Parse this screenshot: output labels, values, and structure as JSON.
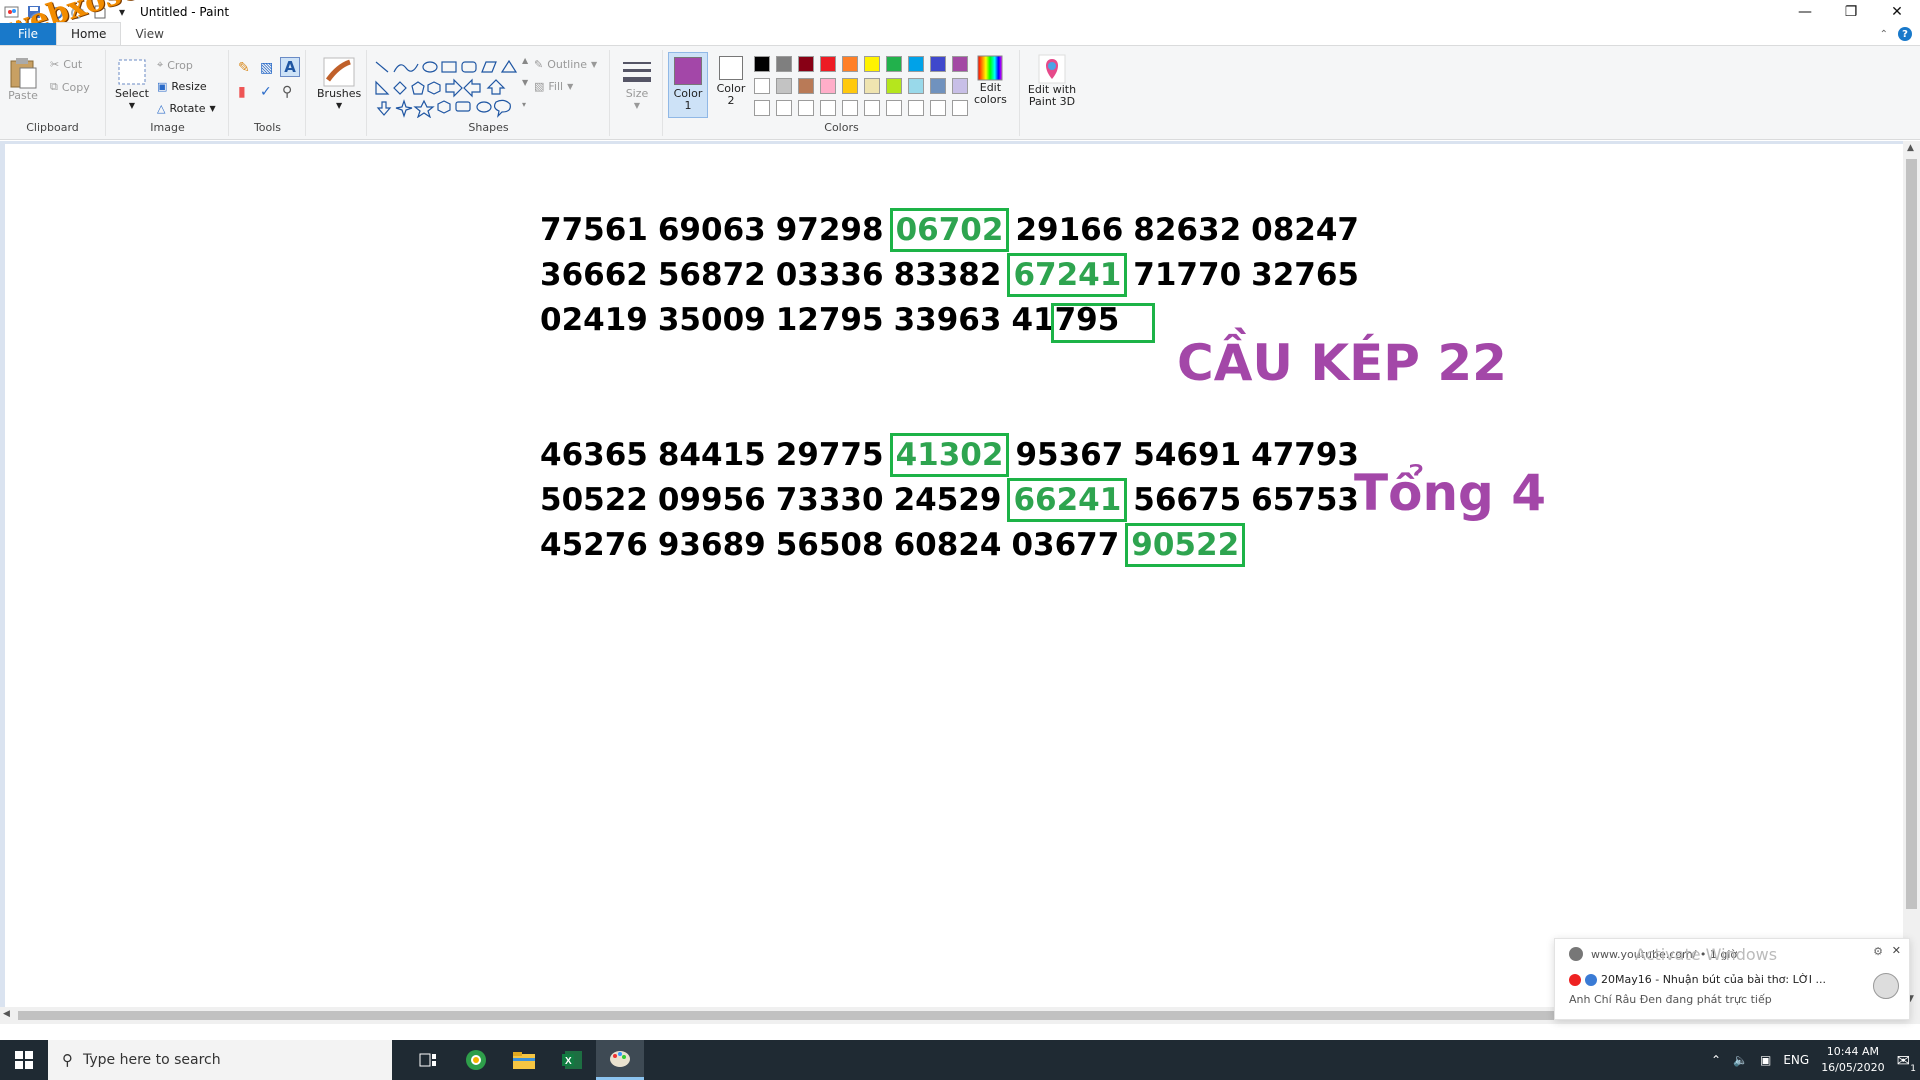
{
  "window": {
    "title": "Untitled - Paint",
    "controls": [
      "minimize",
      "maximize",
      "close"
    ]
  },
  "watermark": {
    "text": "webxoso.net"
  },
  "menu": {
    "tabs": [
      {
        "label": "File"
      },
      {
        "label": "Home"
      },
      {
        "label": "View"
      }
    ]
  },
  "ribbon": {
    "clipboard": {
      "group_label": "Clipboard",
      "paste_label": "Paste",
      "cut_label": "Cut",
      "copy_label": "Copy"
    },
    "image": {
      "group_label": "Image",
      "select_label": "Select",
      "crop_label": "Crop",
      "resize_label": "Resize",
      "rotate_label": "Rotate"
    },
    "tools": {
      "group_label": "Tools"
    },
    "brushes": {
      "label": "Brushes"
    },
    "shapes": {
      "group_label": "Shapes",
      "outline_label": "Outline",
      "fill_label": "Fill"
    },
    "size": {
      "label": "Size"
    },
    "colors": {
      "group_label": "Colors",
      "color1_label": "Color\n1",
      "color1_line1": "Color",
      "color1_line2": "1",
      "color2_line1": "Color",
      "color2_line2": "2",
      "color1_value": "#a347a8",
      "color2_value": "#ffffff",
      "edit_colors_line1": "Edit",
      "edit_colors_line2": "colors",
      "palette_row1": [
        "#000000",
        "#7f7f7f",
        "#880015",
        "#ed1c24",
        "#ff7f27",
        "#fff200",
        "#22b14c",
        "#00a2e8",
        "#3f48cc",
        "#a349a4"
      ],
      "palette_row2": [
        "#ffffff",
        "#c3c3c3",
        "#b97a57",
        "#ffaec9",
        "#ffc90e",
        "#efe4b0",
        "#b5e61d",
        "#99d9ea",
        "#7092be",
        "#c8bfe7"
      ],
      "palette_row3": [
        "#ffffff",
        "#ffffff",
        "#ffffff",
        "#ffffff",
        "#ffffff",
        "#ffffff",
        "#ffffff",
        "#ffffff",
        "#ffffff",
        "#ffffff"
      ]
    },
    "paint3d": {
      "line1": "Edit with",
      "line2": "Paint 3D"
    }
  },
  "canvas": {
    "block1": [
      {
        "nums": [
          "77561",
          "69063",
          "97298",
          "06702",
          "29166",
          "82632",
          "08247"
        ],
        "highlight": 3
      },
      {
        "nums": [
          "36662",
          "56872",
          "03336",
          "83382",
          "67241",
          "71770",
          "32765"
        ],
        "highlight": 4
      },
      {
        "nums": [
          "02419",
          "35009",
          "12795",
          "33963",
          "41795"
        ],
        "highlight": -1
      }
    ],
    "block2": [
      {
        "nums": [
          "46365",
          "84415",
          "29775",
          "41302",
          "95367",
          "54691",
          "47793"
        ],
        "highlight": 3
      },
      {
        "nums": [
          "50522",
          "09956",
          "73330",
          "24529",
          "66241",
          "56675",
          "65753"
        ],
        "highlight": 4
      },
      {
        "nums": [
          "45276",
          "93689",
          "56508",
          "60824",
          "03677",
          "90522"
        ],
        "highlight": 5
      }
    ],
    "title1": "CẦU KÉP 22",
    "title2": "Tổng 4",
    "accent_green": "#1db347",
    "accent_purple": "#a347a8"
  },
  "notification": {
    "source": "www.youtube.com/ • 1 giờ",
    "headline": "20May16 - Nhuận bút của bài thơ: LỜI ...",
    "subtext": "Anh Chí Râu Đen đang phát trực tiếp",
    "overlay": "Activate Windows"
  },
  "taskbar": {
    "search_placeholder": "Type here to search",
    "language": "ENG",
    "time": "10:44 AM",
    "date": "16/05/2020",
    "notification_count": "1"
  }
}
